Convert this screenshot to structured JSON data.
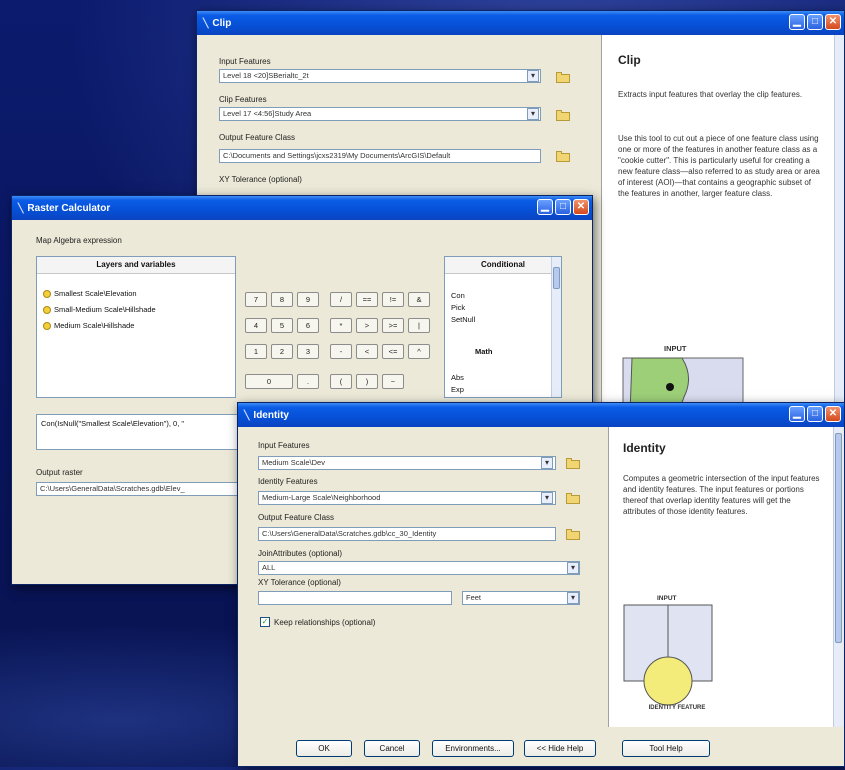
{
  "clip": {
    "title": "Clip",
    "input_features_label": "Input Features",
    "input_features_value": "Level 18 <20]SBerialtc_2t",
    "clip_features_label": "Clip Features",
    "clip_features_value": "Level 17 <4:56]Study Area",
    "output_label": "Output Feature Class",
    "output_value": "C:\\Documents and Settings\\jcxs2319\\My Documents\\ArcGIS\\Default",
    "xy_tolerance_label": "XY Tolerance (optional)",
    "help": {
      "title": "Clip",
      "p1": "Extracts input features that overlay the clip features.",
      "p2": "Use this tool to cut out a piece of one feature class using one or more of the features in another feature class as a \"cookie cutter\". This is particularly useful for creating a new feature class—also referred to as study area or area of interest (AOI)—that contains a geographic subset of the features in another, larger feature class.",
      "diagram_label": "INPUT"
    }
  },
  "raster": {
    "title": "Raster Calculator",
    "map_algebra_label": "Map Algebra expression",
    "layers_header": "Layers and variables",
    "layers": [
      "Smallest Scale\\Elevation",
      "Small-Medium Scale\\Hillshade",
      "Medium Scale\\Hillshade"
    ],
    "keypad": [
      [
        "7",
        "8",
        "9",
        "/",
        "==",
        "!=",
        "&"
      ],
      [
        "4",
        "5",
        "6",
        "*",
        ">",
        ">=",
        "|"
      ],
      [
        "1",
        "2",
        "3",
        "-",
        "<",
        "<=",
        "^"
      ],
      [
        "0",
        ".",
        "(",
        ")",
        "~"
      ]
    ],
    "cond_header": "Conditional",
    "cond_items": [
      "Con",
      "Pick",
      "SetNull"
    ],
    "math_header": "Math",
    "math_items": [
      "Abs",
      "Exp"
    ],
    "expression": "Con(IsNull(\"Smallest Scale\\Elevation\"), 0, \"",
    "output_label": "Output raster",
    "output_value": "C:\\Users\\GeneralData\\Scratches.gdb\\Elev_"
  },
  "identity": {
    "title": "Identity",
    "input_features_label": "Input Features",
    "input_features_value": "Medium Scale\\Dev",
    "identity_features_label": "Identity Features",
    "identity_features_value": "Medium-Large Scale\\Neighborhood",
    "output_label": "Output Feature Class",
    "output_value": "C:\\Users\\GeneralData\\Scratches.gdb\\cc_30_Identity",
    "join_attributes_label": "JoinAttributes (optional)",
    "join_attributes_value": "ALL",
    "xy_tolerance_label": "XY Tolerance (optional)",
    "xy_tolerance_value": "",
    "units_value": "Feet",
    "keep_relationships_label": "Keep relationships (optional)",
    "keep_relationships_checked": true,
    "help": {
      "title": "Identity",
      "p1": "Computes a geometric intersection of the input features and identity features. The input features or portions thereof that overlap identity features will get the attributes of those identity features.",
      "diagram_input_label": "INPUT",
      "diagram_identity_label": "IDENTITY FEATURE"
    },
    "buttons": {
      "ok": "OK",
      "cancel": "Cancel",
      "environments": "Environments...",
      "hide_help": "<< Hide Help",
      "tool_help": "Tool Help"
    }
  },
  "colors": {
    "titlebar": "#0650d6",
    "dialog_bg": "#ece9d8",
    "background": "#0c1a66",
    "layer_dot": "#f3cf3a"
  }
}
